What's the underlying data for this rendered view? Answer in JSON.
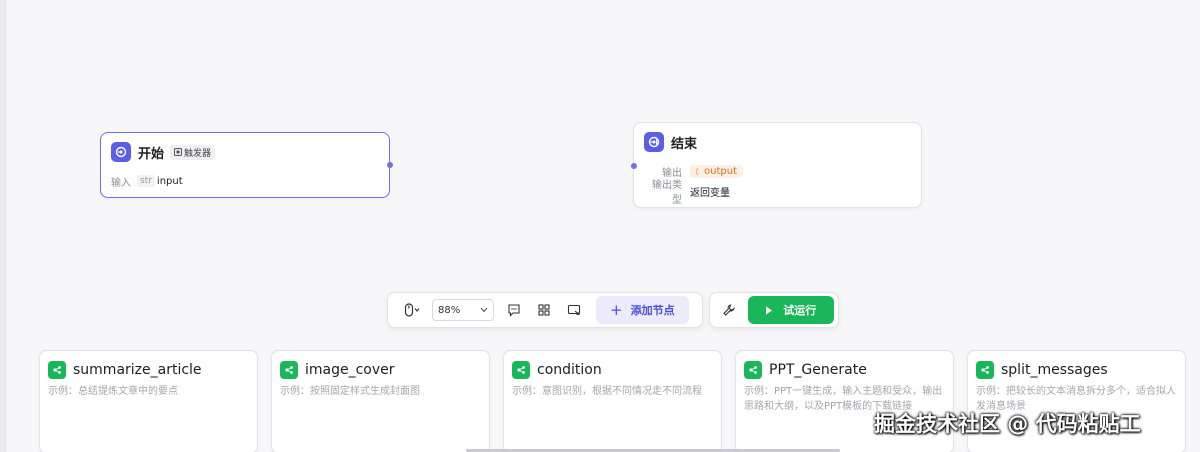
{
  "start_node": {
    "title": "开始",
    "trigger_label": "触发器",
    "input_label": "输入",
    "input_type": "str",
    "input_name": "input"
  },
  "end_node": {
    "title": "结束",
    "output_label": "输出",
    "output_var": "output",
    "output_type_label": "输出类型",
    "output_type_value": "返回变量"
  },
  "toolbar": {
    "zoom": "88%",
    "add_node_label": "添加节点",
    "run_label": "试运行"
  },
  "plugin_cards": [
    {
      "title": "summarize_article",
      "desc": "示例：总结提炼文章中的要点"
    },
    {
      "title": "image_cover",
      "desc": "示例：按照固定样式生成封面图"
    },
    {
      "title": "condition",
      "desc": "示例：意图识别，根据不同情况走不同流程"
    },
    {
      "title": "PPT_Generate",
      "desc": "示例：PPT一键生成，输入主题和受众，输出思路和大纲，以及PPT模板的下载链接"
    },
    {
      "title": "split_messages",
      "desc": "示例：把较长的文本消息拆分多个，适合拟人发消息场景"
    }
  ],
  "watermark": "掘金技术社区 @ 代码粘贴工",
  "colors": {
    "accent": "#5b5fe6",
    "run_green": "#1ab65a",
    "output_orange": "#e46d1e"
  }
}
